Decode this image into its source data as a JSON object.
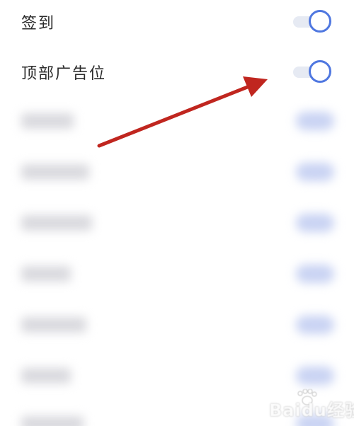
{
  "settings": {
    "items": [
      {
        "label": "签到",
        "toggle_state": "on"
      },
      {
        "label": "顶部广告位",
        "toggle_state": "on"
      }
    ]
  },
  "blurred_items_count_visible": 7,
  "colors": {
    "toggle_accent": "#4f77e0",
    "toggle_track": "#e6eaf3",
    "arrow": "#c0261f",
    "background": "#ffffff"
  },
  "annotation": {
    "arrow_icon": "arrow-pointer-icon"
  },
  "watermark": {
    "text": "Baidu经验"
  }
}
